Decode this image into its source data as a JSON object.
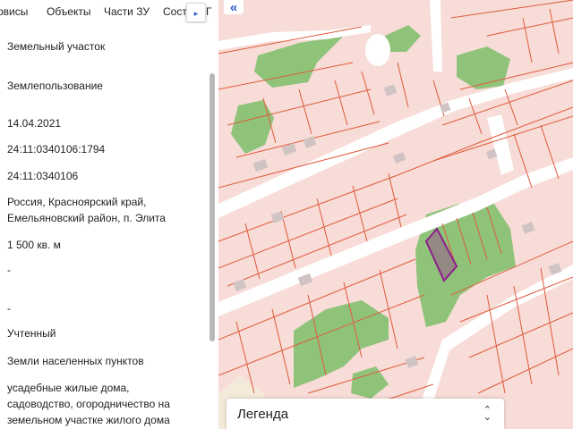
{
  "tabs": {
    "items": [
      "рвисы",
      "Объекты",
      "Части ЗУ",
      "Соста"
    ],
    "overflow": "Г",
    "expand_icon": "▸"
  },
  "parcel": {
    "object_type": "Земельный участок",
    "object_kind": "Землепользование",
    "date": "14.04.2021",
    "cadastral_number": "24:11:0340106:1794",
    "quarter_number": "24:11:0340106",
    "address_line1": "Россия, Красноярский край,",
    "address_line2": "Емельяновский район, п. Элита",
    "area": "1 500 кв. м",
    "dash1": "-",
    "dash2": "-",
    "status": "Учтенный",
    "category": "Земли населенных пунктов",
    "usage_line1": "усадебные жилые дома,",
    "usage_line2": "садоводство, огородничество на",
    "usage_line3": "земельном участке жилого дома"
  },
  "map": {
    "collapse_icon": "«",
    "legend_label": "Легенда",
    "legend_chevron_up": "⌃",
    "legend_chevron_down": "⌄",
    "colors": {
      "parcel_fill": "#f7dcd7",
      "parcel_stroke": "#e05a3c",
      "green": "#8fc37a",
      "road": "#ffffff",
      "highlight": "#8e1f8c",
      "building": "#cfc3c3"
    }
  }
}
